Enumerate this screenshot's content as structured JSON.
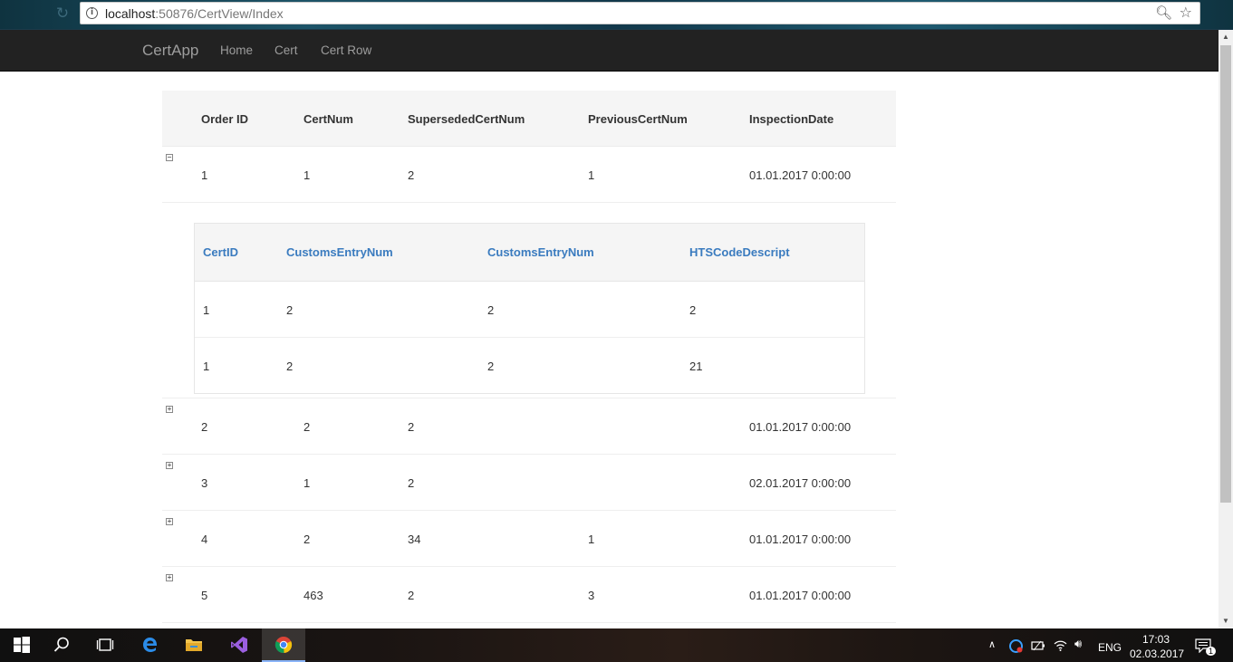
{
  "browser": {
    "url_host": "localhost",
    "url_path": ":50876/CertView/Index"
  },
  "navbar": {
    "brand": "CertApp",
    "links": [
      "Home",
      "Cert",
      "Cert Row"
    ]
  },
  "grid": {
    "headers": [
      "Order ID",
      "CertNum",
      "SupersededCertNum",
      "PreviousCertNum",
      "InspectionDate"
    ],
    "rows": [
      {
        "expanded": true,
        "values": [
          "1",
          "1",
          "2",
          "1",
          "01.01.2017 0:00:00"
        ]
      },
      {
        "expanded": false,
        "values": [
          "2",
          "2",
          "2",
          "",
          "01.01.2017 0:00:00"
        ]
      },
      {
        "expanded": false,
        "values": [
          "3",
          "1",
          "2",
          "",
          "02.01.2017 0:00:00"
        ]
      },
      {
        "expanded": false,
        "values": [
          "4",
          "2",
          "34",
          "1",
          "01.01.2017 0:00:00"
        ]
      },
      {
        "expanded": false,
        "values": [
          "5",
          "463",
          "2",
          "3",
          "01.01.2017 0:00:00"
        ]
      }
    ]
  },
  "detail": {
    "headers": [
      "CertID",
      "CustomsEntryNum",
      "CustomsEntryNum",
      "HTSCodeDescript"
    ],
    "rows": [
      [
        "1",
        "2",
        "2",
        "2"
      ],
      [
        "1",
        "2",
        "2",
        "21"
      ]
    ]
  },
  "taskbar": {
    "language": "ENG",
    "time": "17:03",
    "date": "02.03.2017",
    "notification_count": "1"
  }
}
